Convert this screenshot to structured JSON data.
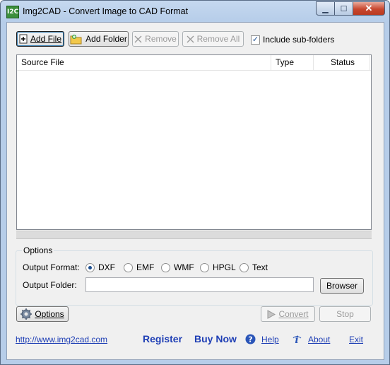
{
  "window": {
    "title": "Img2CAD - Convert Image to CAD Format",
    "app_icon_text": "I2C",
    "minimize_glyph": "▁",
    "maximize_glyph": "☐",
    "close_glyph": "✕"
  },
  "toolbar": {
    "add_file": "Add File",
    "add_folder": "Add Folder",
    "remove": "Remove",
    "remove_all": "Remove All",
    "include_subfolders": "Include sub-folders",
    "include_subfolders_checked": true
  },
  "file_list": {
    "columns": [
      "Source File",
      "Type",
      "Status"
    ],
    "rows": []
  },
  "options": {
    "group_label": "Options",
    "output_format_label": "Output Format:",
    "formats": [
      "DXF",
      "EMF",
      "WMF",
      "HPGL",
      "Text"
    ],
    "selected_format": "DXF",
    "output_folder_label": "Output Folder:",
    "output_folder_value": "",
    "browser_button": "Browser"
  },
  "actions": {
    "options_button": "Options",
    "convert_button": "Convert",
    "stop_button": "Stop"
  },
  "footer": {
    "website": "http://www.img2cad.com",
    "register": "Register",
    "buy_now": "Buy Now",
    "help": "Help",
    "about": "About",
    "exit": "Exit"
  },
  "colors": {
    "link": "#1f3fb5",
    "close_button": "#c8472f",
    "titlebar": "#b6cde9"
  },
  "icons": {
    "add_file": "document-add-icon",
    "add_folder": "folder-add-icon",
    "remove": "x-icon",
    "remove_all": "x-icon",
    "options": "gear-icon",
    "convert": "play-icon",
    "help": "question-icon",
    "about": "info-icon"
  }
}
